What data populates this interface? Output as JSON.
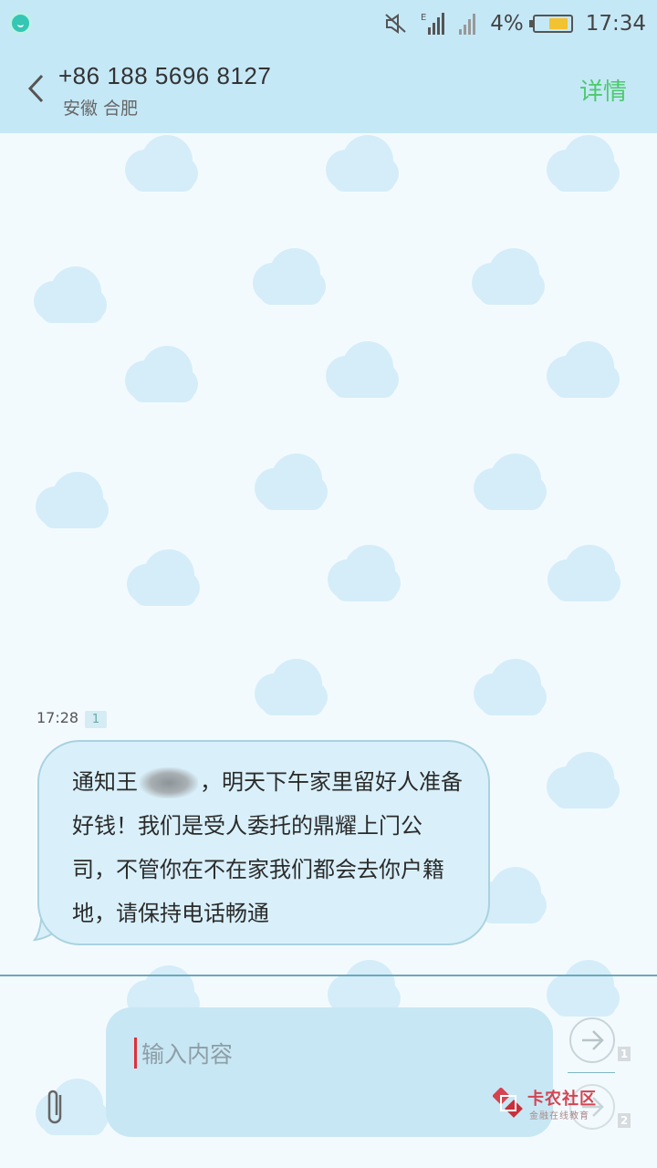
{
  "status_bar": {
    "battery_percent": "4%",
    "time": "17:34",
    "network_type": "E",
    "icons": [
      "app-smile-icon",
      "mute-icon",
      "signal-e-icon",
      "signal-icon",
      "battery-icon"
    ]
  },
  "header": {
    "phone_number": "+86 188 5696 8127",
    "location": "安徽 合肥",
    "details_label": "详情"
  },
  "conversation": {
    "message": {
      "time": "17:28",
      "sim_slot": "1",
      "text_before": "通知王",
      "text_after": "，明天下午家里留好人准备好钱！我们是受人委托的鼎耀上门公司，不管你在不在家我们都会去你户籍地，请保持电话畅通"
    }
  },
  "composer": {
    "placeholder": "输入内容",
    "send_sim1": "1",
    "send_sim2": "2"
  },
  "watermark": {
    "title": "卡农社区",
    "subtitle": "金融在线教育"
  },
  "colors": {
    "header_bg": "#c5e8f7",
    "details": "#4cc96c",
    "bubble_bg": "#d9f0fa",
    "caret": "#e0303a"
  }
}
